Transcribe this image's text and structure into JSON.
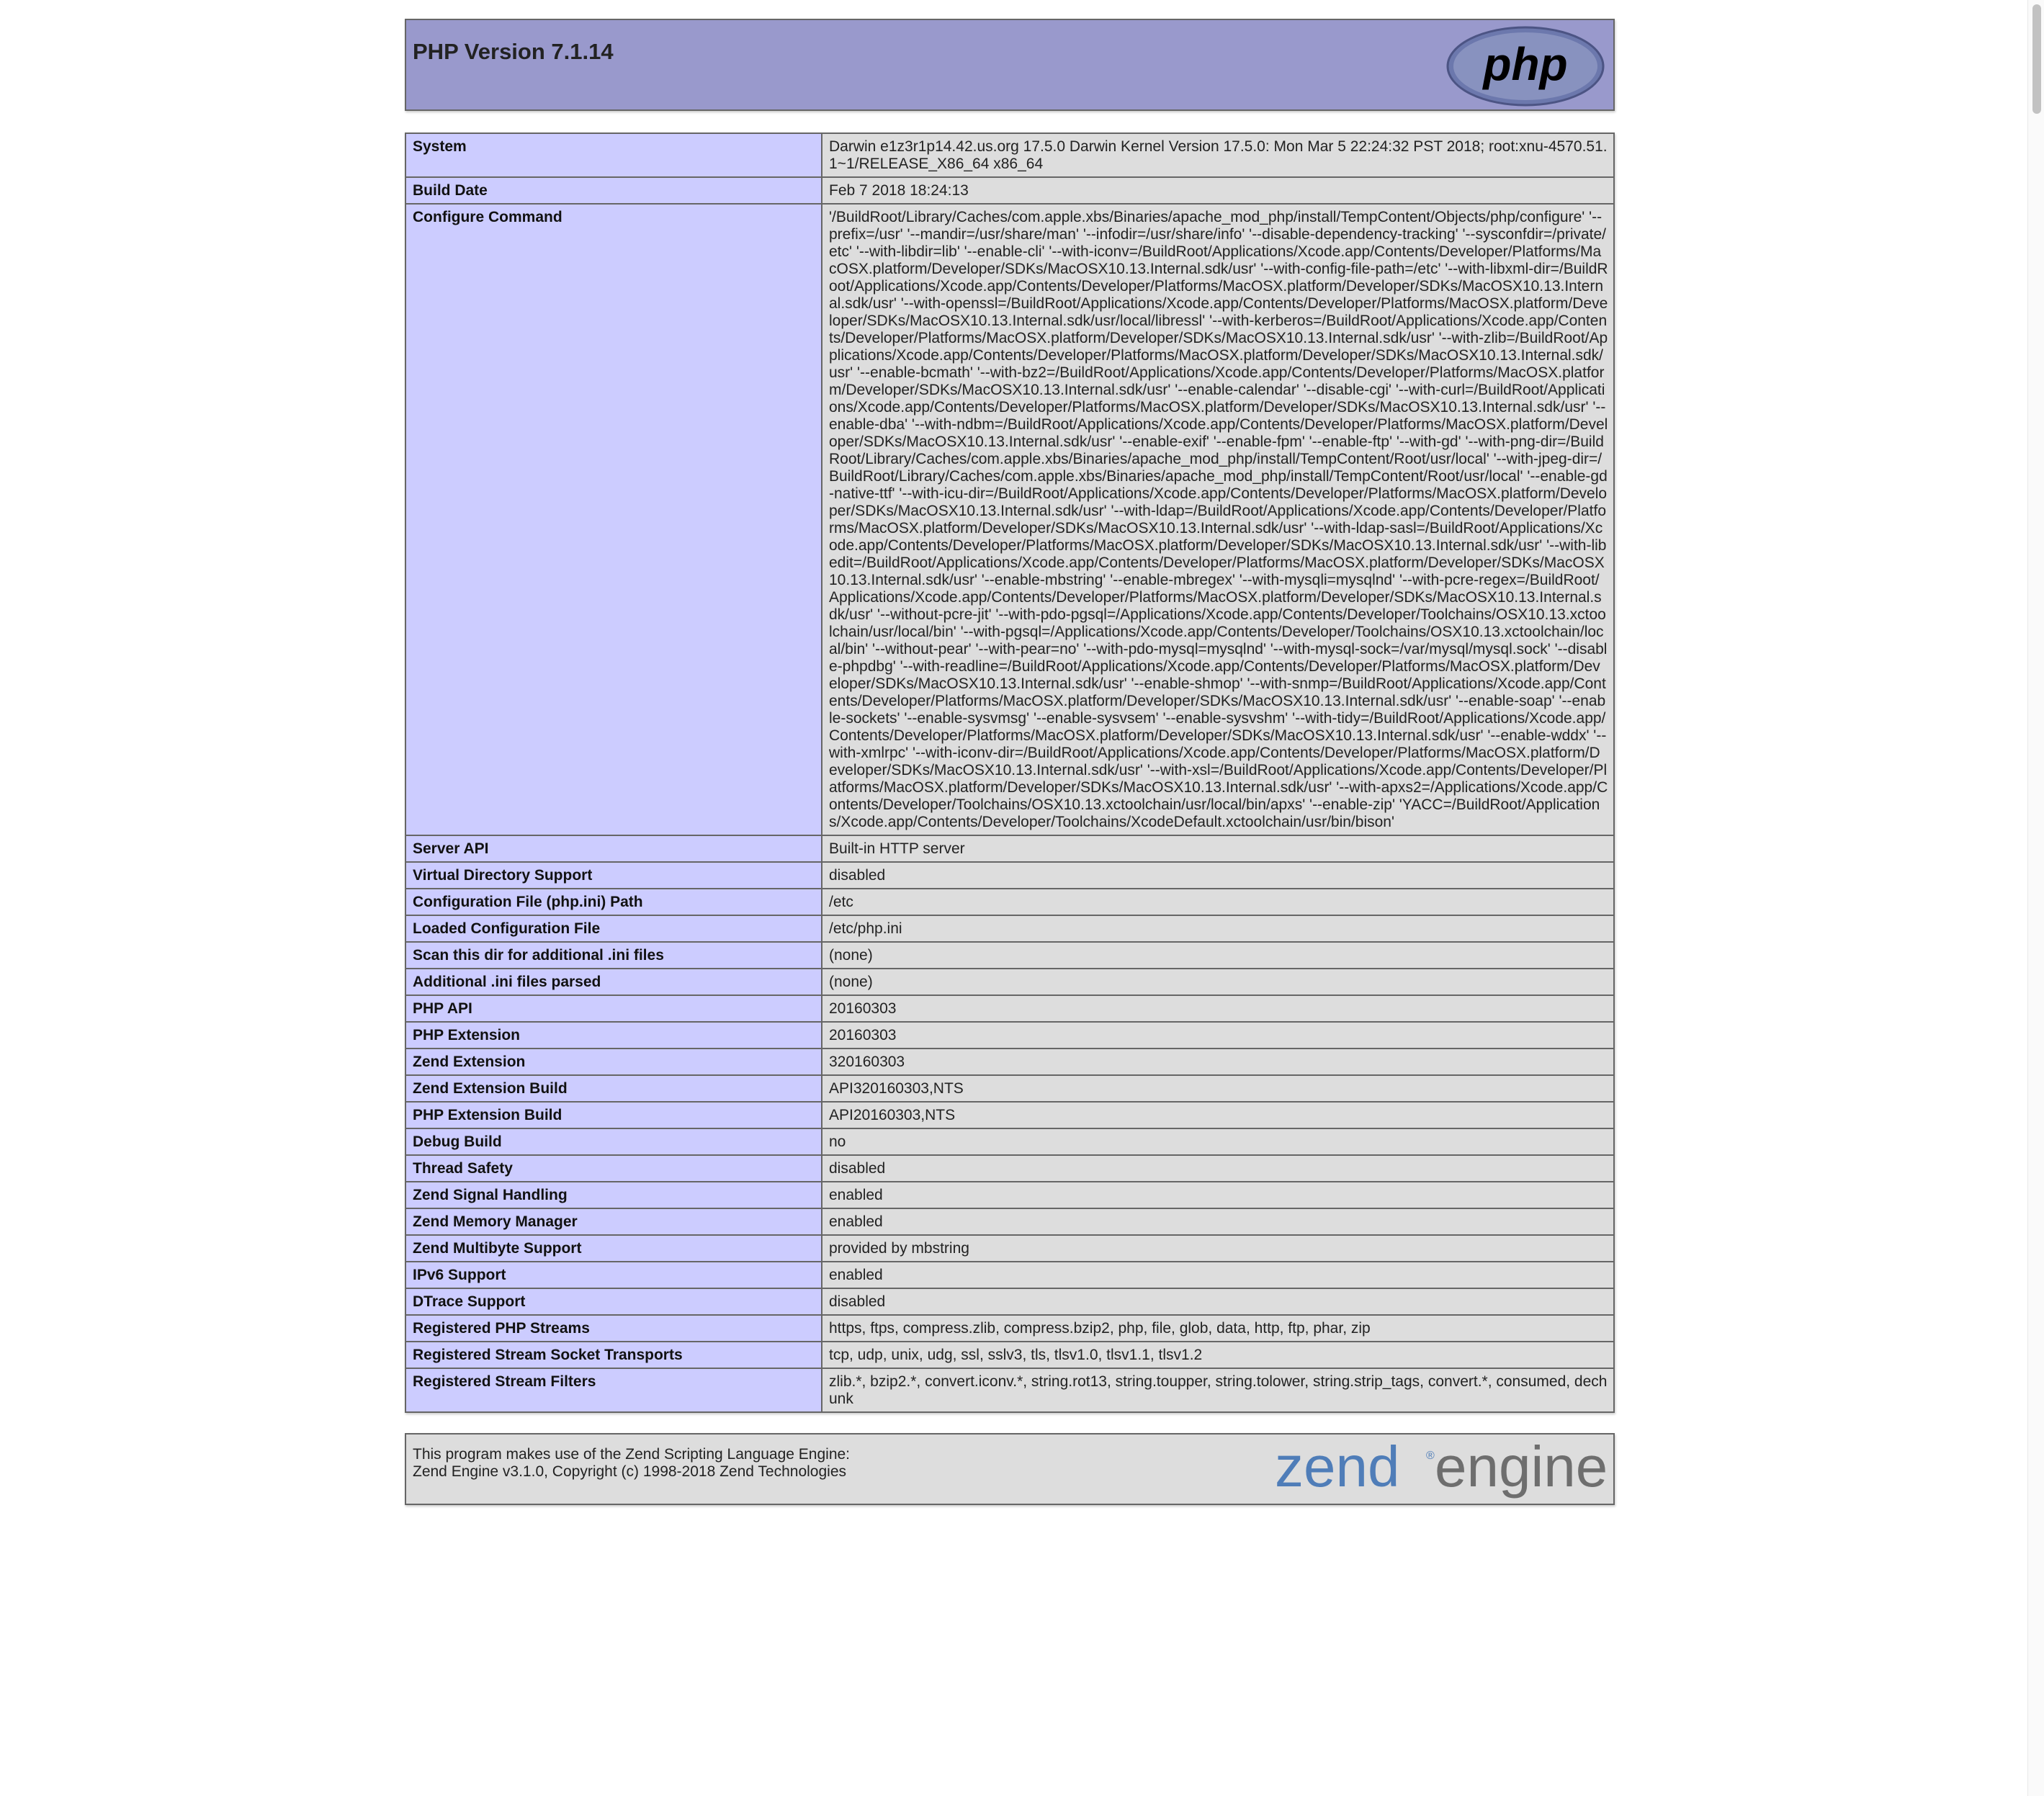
{
  "header": {
    "title": "PHP Version 7.1.14",
    "logo_text": "php"
  },
  "rows": [
    {
      "key": "System",
      "value": "Darwin e1z3r1p14.42.us.org 17.5.0 Darwin Kernel Version 17.5.0: Mon Mar 5 22:24:32 PST 2018; root:xnu-4570.51.1~1/RELEASE_X86_64 x86_64"
    },
    {
      "key": "Build Date",
      "value": "Feb 7 2018 18:24:13"
    },
    {
      "key": "Configure Command",
      "value": "'/BuildRoot/Library/Caches/com.apple.xbs/Binaries/apache_mod_php/install/TempContent/Objects/php/configure' '--prefix=/usr' '--mandir=/usr/share/man' '--infodir=/usr/share/info' '--disable-dependency-tracking' '--sysconfdir=/private/etc' '--with-libdir=lib' '--enable-cli' '--with-iconv=/BuildRoot/Applications/Xcode.app/Contents/Developer/Platforms/MacOSX.platform/Developer/SDKs/MacOSX10.13.Internal.sdk/usr' '--with-config-file-path=/etc' '--with-libxml-dir=/BuildRoot/Applications/Xcode.app/Contents/Developer/Platforms/MacOSX.platform/Developer/SDKs/MacOSX10.13.Internal.sdk/usr' '--with-openssl=/BuildRoot/Applications/Xcode.app/Contents/Developer/Platforms/MacOSX.platform/Developer/SDKs/MacOSX10.13.Internal.sdk/usr/local/libressl' '--with-kerberos=/BuildRoot/Applications/Xcode.app/Contents/Developer/Platforms/MacOSX.platform/Developer/SDKs/MacOSX10.13.Internal.sdk/usr' '--with-zlib=/BuildRoot/Applications/Xcode.app/Contents/Developer/Platforms/MacOSX.platform/Developer/SDKs/MacOSX10.13.Internal.sdk/usr' '--enable-bcmath' '--with-bz2=/BuildRoot/Applications/Xcode.app/Contents/Developer/Platforms/MacOSX.platform/Developer/SDKs/MacOSX10.13.Internal.sdk/usr' '--enable-calendar' '--disable-cgi' '--with-curl=/BuildRoot/Applications/Xcode.app/Contents/Developer/Platforms/MacOSX.platform/Developer/SDKs/MacOSX10.13.Internal.sdk/usr' '--enable-dba' '--with-ndbm=/BuildRoot/Applications/Xcode.app/Contents/Developer/Platforms/MacOSX.platform/Developer/SDKs/MacOSX10.13.Internal.sdk/usr' '--enable-exif' '--enable-fpm' '--enable-ftp' '--with-gd' '--with-png-dir=/BuildRoot/Library/Caches/com.apple.xbs/Binaries/apache_mod_php/install/TempContent/Root/usr/local' '--with-jpeg-dir=/BuildRoot/Library/Caches/com.apple.xbs/Binaries/apache_mod_php/install/TempContent/Root/usr/local' '--enable-gd-native-ttf' '--with-icu-dir=/BuildRoot/Applications/Xcode.app/Contents/Developer/Platforms/MacOSX.platform/Developer/SDKs/MacOSX10.13.Internal.sdk/usr' '--with-ldap=/BuildRoot/Applications/Xcode.app/Contents/Developer/Platforms/MacOSX.platform/Developer/SDKs/MacOSX10.13.Internal.sdk/usr' '--with-ldap-sasl=/BuildRoot/Applications/Xcode.app/Contents/Developer/Platforms/MacOSX.platform/Developer/SDKs/MacOSX10.13.Internal.sdk/usr' '--with-libedit=/BuildRoot/Applications/Xcode.app/Contents/Developer/Platforms/MacOSX.platform/Developer/SDKs/MacOSX10.13.Internal.sdk/usr' '--enable-mbstring' '--enable-mbregex' '--with-mysqli=mysqlnd' '--with-pcre-regex=/BuildRoot/Applications/Xcode.app/Contents/Developer/Platforms/MacOSX.platform/Developer/SDKs/MacOSX10.13.Internal.sdk/usr' '--without-pcre-jit' '--with-pdo-pgsql=/Applications/Xcode.app/Contents/Developer/Toolchains/OSX10.13.xctoolchain/usr/local/bin' '--with-pgsql=/Applications/Xcode.app/Contents/Developer/Toolchains/OSX10.13.xctoolchain/local/bin' '--without-pear' '--with-pear=no' '--with-pdo-mysql=mysqlnd' '--with-mysql-sock=/var/mysql/mysql.sock' '--disable-phpdbg' '--with-readline=/BuildRoot/Applications/Xcode.app/Contents/Developer/Platforms/MacOSX.platform/Developer/SDKs/MacOSX10.13.Internal.sdk/usr' '--enable-shmop' '--with-snmp=/BuildRoot/Applications/Xcode.app/Contents/Developer/Platforms/MacOSX.platform/Developer/SDKs/MacOSX10.13.Internal.sdk/usr' '--enable-soap' '--enable-sockets' '--enable-sysvmsg' '--enable-sysvsem' '--enable-sysvshm' '--with-tidy=/BuildRoot/Applications/Xcode.app/Contents/Developer/Platforms/MacOSX.platform/Developer/SDKs/MacOSX10.13.Internal.sdk/usr' '--enable-wddx' '--with-xmlrpc' '--with-iconv-dir=/BuildRoot/Applications/Xcode.app/Contents/Developer/Platforms/MacOSX.platform/Developer/SDKs/MacOSX10.13.Internal.sdk/usr' '--with-xsl=/BuildRoot/Applications/Xcode.app/Contents/Developer/Platforms/MacOSX.platform/Developer/SDKs/MacOSX10.13.Internal.sdk/usr' '--with-apxs2=/Applications/Xcode.app/Contents/Developer/Toolchains/OSX10.13.xctoolchain/usr/local/bin/apxs' '--enable-zip' 'YACC=/BuildRoot/Applications/Xcode.app/Contents/Developer/Toolchains/XcodeDefault.xctoolchain/usr/bin/bison'"
    },
    {
      "key": "Server API",
      "value": "Built-in HTTP server"
    },
    {
      "key": "Virtual Directory Support",
      "value": "disabled"
    },
    {
      "key": "Configuration File (php.ini) Path",
      "value": "/etc"
    },
    {
      "key": "Loaded Configuration File",
      "value": "/etc/php.ini"
    },
    {
      "key": "Scan this dir for additional .ini files",
      "value": "(none)"
    },
    {
      "key": "Additional .ini files parsed",
      "value": "(none)"
    },
    {
      "key": "PHP API",
      "value": "20160303"
    },
    {
      "key": "PHP Extension",
      "value": "20160303"
    },
    {
      "key": "Zend Extension",
      "value": "320160303"
    },
    {
      "key": "Zend Extension Build",
      "value": "API320160303,NTS"
    },
    {
      "key": "PHP Extension Build",
      "value": "API20160303,NTS"
    },
    {
      "key": "Debug Build",
      "value": "no"
    },
    {
      "key": "Thread Safety",
      "value": "disabled"
    },
    {
      "key": "Zend Signal Handling",
      "value": "enabled"
    },
    {
      "key": "Zend Memory Manager",
      "value": "enabled"
    },
    {
      "key": "Zend Multibyte Support",
      "value": "provided by mbstring"
    },
    {
      "key": "IPv6 Support",
      "value": "enabled"
    },
    {
      "key": "DTrace Support",
      "value": "disabled"
    },
    {
      "key": "Registered PHP Streams",
      "value": "https, ftps, compress.zlib, compress.bzip2, php, file, glob, data, http, ftp, phar, zip"
    },
    {
      "key": "Registered Stream Socket Transports",
      "value": "tcp, udp, unix, udg, ssl, sslv3, tls, tlsv1.0, tlsv1.1, tlsv1.2"
    },
    {
      "key": "Registered Stream Filters",
      "value": "zlib.*, bzip2.*, convert.iconv.*, string.rot13, string.toupper, string.tolower, string.strip_tags, convert.*, consumed, dechunk"
    }
  ],
  "footer": {
    "line1": "This program makes use of the Zend Scripting Language Engine:",
    "line2": "Zend Engine v3.1.0, Copyright (c) 1998-2018 Zend Technologies",
    "logo_zend": "zend",
    "logo_engine": "engine",
    "logo_mark": "®"
  },
  "colors": {
    "header_bg": "#9999cc",
    "key_bg": "#ccccff",
    "value_bg": "#dddddd",
    "border": "#666666",
    "zend_blue": "#4f7db8",
    "zend_gray": "#6e6e6e"
  },
  "icons": {
    "php_logo": "php-logo-icon",
    "zend_logo": "zend-engine-logo-icon"
  }
}
